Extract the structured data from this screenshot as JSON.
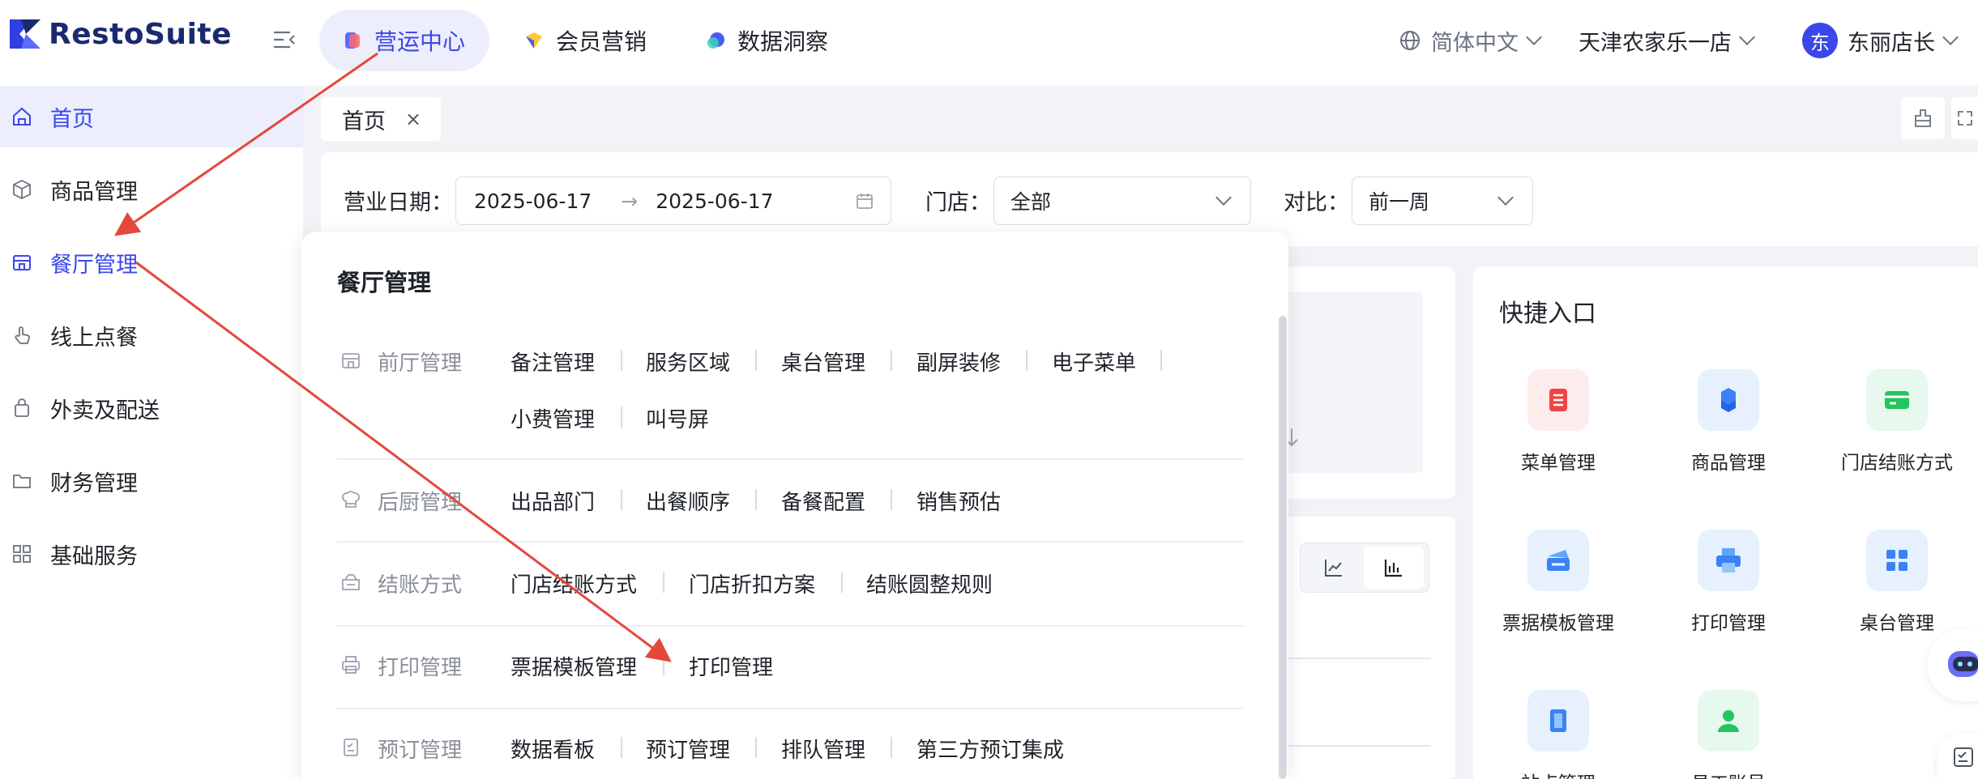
{
  "app": {
    "brand": "RestoSuite"
  },
  "header": {
    "tabs": [
      {
        "label": "营运中心",
        "active": true
      },
      {
        "label": "会员营销",
        "active": false
      },
      {
        "label": "数据洞察",
        "active": false
      }
    ],
    "language": "简体中文",
    "store": "天津农家乐一店",
    "user": {
      "avatar_char": "东",
      "name": "东丽店长"
    }
  },
  "sidebar": {
    "items": [
      {
        "label": "首页",
        "icon": "home-icon",
        "state": "active"
      },
      {
        "label": "商品管理",
        "icon": "cube-icon",
        "state": "normal"
      },
      {
        "label": "餐厅管理",
        "icon": "store-icon",
        "state": "hover"
      },
      {
        "label": "线上点餐",
        "icon": "tap-icon",
        "state": "normal"
      },
      {
        "label": "外卖及配送",
        "icon": "bag-icon",
        "state": "normal"
      },
      {
        "label": "财务管理",
        "icon": "folder-icon",
        "state": "normal"
      },
      {
        "label": "基础服务",
        "icon": "grid-icon",
        "state": "normal"
      }
    ]
  },
  "page_tab": {
    "label": "首页",
    "close": "×"
  },
  "filter": {
    "date_label": "营业日期：",
    "date_start": "2025-06-17",
    "date_sep": "→",
    "date_end": "2025-06-17",
    "store_label": "门店：",
    "store_value": "全部",
    "compare_label": "对比：",
    "compare_value": "前一周"
  },
  "quick": {
    "title": "快捷入口",
    "items": [
      {
        "label": "菜单管理",
        "color": "#ef4444",
        "bg": "#fdecec"
      },
      {
        "label": "商品管理",
        "color": "#3b82f6",
        "bg": "#e6f1fd"
      },
      {
        "label": "门店结账方式",
        "color": "#22c55e",
        "bg": "#e7f8ee"
      },
      {
        "label": "票据模板管理",
        "color": "#3b82f6",
        "bg": "#e6f1fd"
      },
      {
        "label": "打印管理",
        "color": "#3b82f6",
        "bg": "#e6f1fd"
      },
      {
        "label": "桌台管理",
        "color": "#3b82f6",
        "bg": "#e6f1fd"
      },
      {
        "label": "站点管理",
        "color": "#3b82f6",
        "bg": "#e6f1fd"
      },
      {
        "label": "员工账号",
        "color": "#22c55e",
        "bg": "#e7f8ee"
      }
    ]
  },
  "menu_panel": {
    "title": "餐厅管理",
    "groups": [
      {
        "label": "前厅管理",
        "items": [
          "备注管理",
          "服务区域",
          "桌台管理",
          "副屏装修",
          "电子菜单",
          "小费管理",
          "叫号屏"
        ]
      },
      {
        "label": "后厨管理",
        "items": [
          "出品部门",
          "出餐顺序",
          "备餐配置",
          "销售预估"
        ]
      },
      {
        "label": "结账方式",
        "items": [
          "门店结账方式",
          "门店折扣方案",
          "结账圆整规则"
        ]
      },
      {
        "label": "打印管理",
        "items": [
          "票据模板管理",
          "打印管理"
        ]
      },
      {
        "label": "预订管理",
        "items": [
          "数据看板",
          "预订管理",
          "排队管理",
          "第三方预订集成"
        ]
      }
    ]
  },
  "colors": {
    "accent": "#3b47e8",
    "arrow": "#e5473a",
    "active_bg": "#eceefb"
  }
}
